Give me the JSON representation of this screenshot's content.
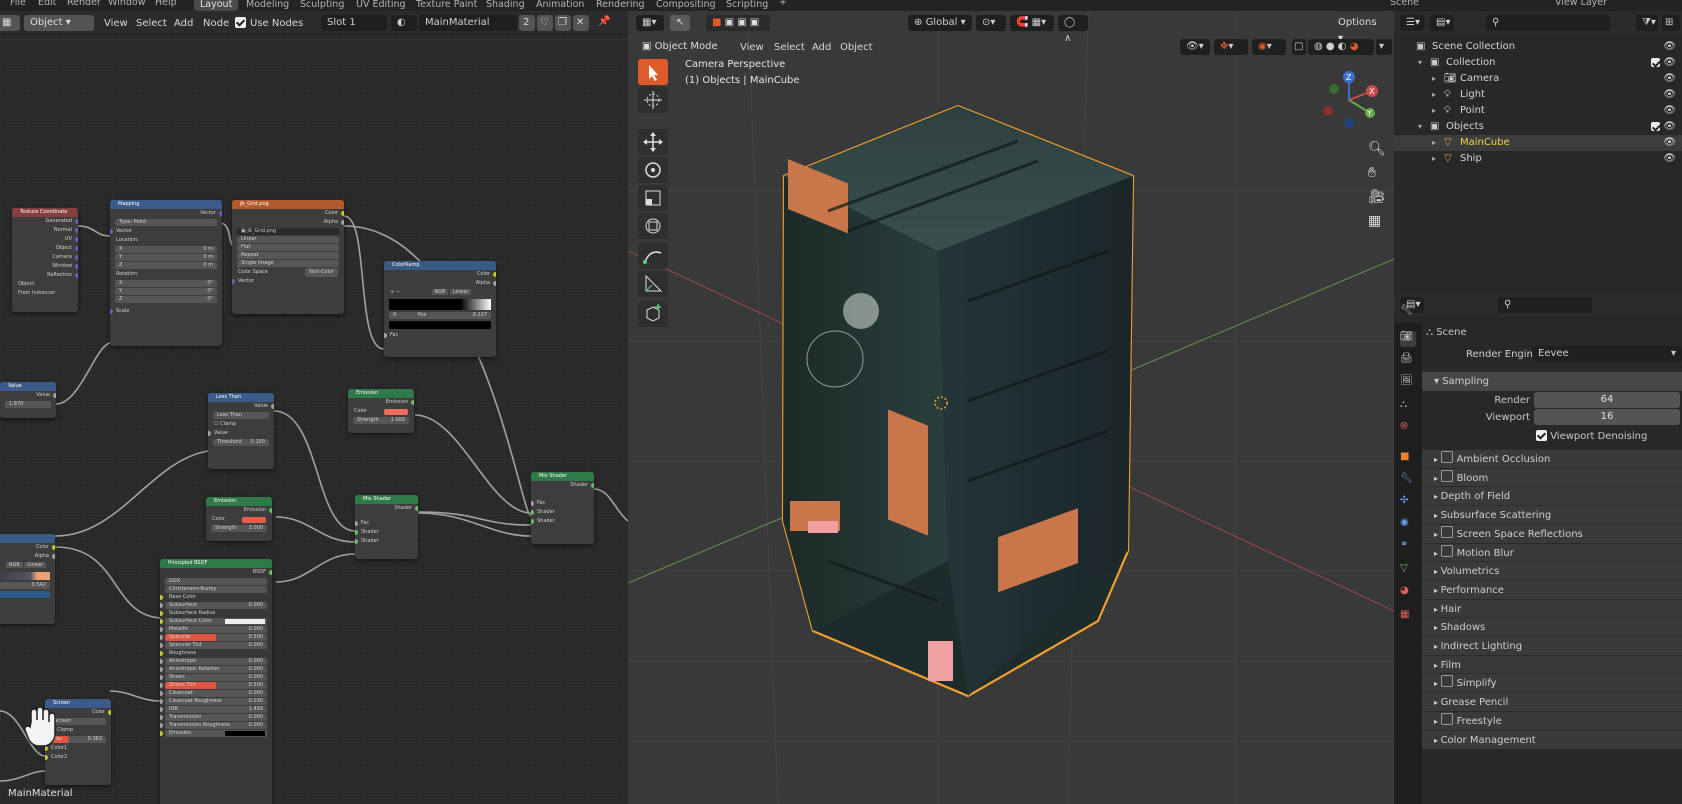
{
  "topbar": {
    "menus": [
      "File",
      "Edit",
      "Render",
      "Window",
      "Help"
    ],
    "workspaces": [
      "Layout",
      "Modeling",
      "Sculpting",
      "UV Editing",
      "Texture Paint",
      "Shading",
      "Animation",
      "Rendering",
      "Compositing",
      "Scripting"
    ],
    "add_tab": "+",
    "scene": "Scene",
    "view_layer": "View Layer"
  },
  "node_editor": {
    "mode": "Object",
    "menus": [
      "View",
      "Select",
      "Add",
      "Node"
    ],
    "use_nodes": "Use Nodes",
    "slot": "Slot 1",
    "material": "MainMaterial",
    "users": "2",
    "footer_material": "MainMaterial",
    "nodes": {
      "texcoord": {
        "title": "Texture Coordinate",
        "outputs": [
          "Generated",
          "Normal",
          "UV",
          "Object",
          "Camera",
          "Window",
          "Reflection"
        ],
        "object_label": "Object",
        "from_instancer": "From Instancer"
      },
      "mapping": {
        "title": "Mapping",
        "out": "Vector",
        "type_label": "Type:",
        "type_value": "Point",
        "vector": "Vector",
        "location": "Location:",
        "loc": [
          "0 m",
          "0 m",
          "0 m"
        ],
        "rotation": "Rotation:",
        "rot": [
          "0°",
          "0°",
          "0°"
        ],
        "axes": [
          "X",
          "Y",
          "Z"
        ],
        "scale": "Scale"
      },
      "image": {
        "title": "jb_Grid.png",
        "outputs": [
          "Color",
          "Alpha"
        ],
        "file": "jb_Grid.png",
        "interp": "Linear",
        "proj": "Flat",
        "ext": "Repeat",
        "source": "Single Image",
        "colorspace_label": "Color Space",
        "colorspace": "Non-Color",
        "vector": "Vector"
      },
      "colorramp": {
        "title": "ColorRamp",
        "outputs": [
          "Color",
          "Alpha"
        ],
        "mode": "RGB",
        "interp": "Linear",
        "pos_index": "0",
        "pos_label": "Pos",
        "pos_value": "0.227",
        "fac": "Fac"
      },
      "value": {
        "title": "Value",
        "out": "Value",
        "val": "1.870"
      },
      "lessthan": {
        "title": "Less Than",
        "out": "Value",
        "op": "Less Than",
        "clamp": "Clamp",
        "value": "Value",
        "threshold_label": "Threshold",
        "threshold": "0.100"
      },
      "emission1": {
        "title": "Emission",
        "out": "Emission",
        "color": "Color",
        "strength_label": "Strength",
        "strength": "1.000"
      },
      "emission2": {
        "title": "Emission",
        "out": "Emission",
        "color": "Color",
        "strength_label": "Strength",
        "strength": "3.000"
      },
      "mix1": {
        "title": "Mix Shader",
        "out": "Shader",
        "inputs": [
          "Fac",
          "Shader",
          "Shader"
        ]
      },
      "mix2": {
        "title": "Mix Shader",
        "out": "Shader",
        "inputs": [
          "Fac",
          "Shader",
          "Shader"
        ]
      },
      "bsdf": {
        "title": "Principled BSDF",
        "out": "BSDF",
        "dist": "GGX",
        "sss": "Christensen-Burley",
        "rows": [
          [
            "Base Color",
            ""
          ],
          [
            "Subsurface",
            "0.000"
          ],
          [
            "Subsurface Radius",
            ""
          ],
          [
            "Subsurface Color",
            ""
          ],
          [
            "Metallic",
            "0.000"
          ],
          [
            "Specular",
            "0.500"
          ],
          [
            "Specular Tint",
            "0.000"
          ],
          [
            "Roughness",
            ""
          ],
          [
            "Anisotropic",
            "0.000"
          ],
          [
            "Anisotropic Rotation",
            "0.000"
          ],
          [
            "Sheen",
            "0.000"
          ],
          [
            "Sheen Tint",
            "0.500"
          ],
          [
            "Clearcoat",
            "0.000"
          ],
          [
            "Clearcoat Roughness",
            "0.030"
          ],
          [
            "IOR",
            "1.450"
          ],
          [
            "Transmission",
            "0.000"
          ],
          [
            "Transmission Roughness",
            "0.000"
          ],
          [
            "Emission",
            ""
          ]
        ]
      },
      "screen": {
        "title": "Screen",
        "out": "Color",
        "mode": "Screen",
        "clamp": "Clamp",
        "fac_label": "Fac",
        "fac": "0.363",
        "in1": "Color1",
        "in2": "Color2"
      },
      "left1": {
        "outputs": [
          "Color",
          "Alpha"
        ],
        "ramp_a": "RGB",
        "ramp_b": "Linear",
        "val": "0.542"
      }
    }
  },
  "viewport": {
    "orientation": "Global",
    "options": "Options",
    "mode": "Object Mode",
    "menus": [
      "View",
      "Select",
      "Add",
      "Object"
    ],
    "info_line1": "Camera Perspective",
    "info_line2": "(1) Objects | MainCube",
    "gizmo": {
      "x": "X",
      "y": "Y",
      "z": "Z"
    }
  },
  "outliner": {
    "items": [
      {
        "label": "Scene Collection",
        "indent": 0
      },
      {
        "label": "Collection",
        "indent": 1
      },
      {
        "label": "Camera",
        "indent": 2
      },
      {
        "label": "Light",
        "indent": 2
      },
      {
        "label": "Point",
        "indent": 2
      },
      {
        "label": "Objects",
        "indent": 1
      },
      {
        "label": "MainCube",
        "indent": 2
      },
      {
        "label": "Ship",
        "indent": 2
      }
    ]
  },
  "properties": {
    "scene": "Scene",
    "render_engine_label": "Render Engine",
    "render_engine": "Eevee",
    "sampling": "Sampling",
    "render_label": "Render",
    "render_value": "64",
    "viewport_label": "Viewport",
    "viewport_value": "16",
    "denoise": "Viewport Denoising",
    "panels": [
      {
        "label": "Ambient Occlusion",
        "check": true
      },
      {
        "label": "Bloom",
        "check": true
      },
      {
        "label": "Depth of Field",
        "check": false
      },
      {
        "label": "Subsurface Scattering",
        "check": false
      },
      {
        "label": "Screen Space Reflections",
        "check": true
      },
      {
        "label": "Motion Blur",
        "check": true
      },
      {
        "label": "Volumetrics",
        "check": false
      },
      {
        "label": "Performance",
        "check": false
      },
      {
        "label": "Hair",
        "check": false
      },
      {
        "label": "Shadows",
        "check": false
      },
      {
        "label": "Indirect Lighting",
        "check": false
      },
      {
        "label": "Film",
        "check": false
      },
      {
        "label": "Simplify",
        "check": true
      },
      {
        "label": "Grease Pencil",
        "check": false
      },
      {
        "label": "Freestyle",
        "check": true
      },
      {
        "label": "Color Management",
        "check": false
      }
    ]
  },
  "colors": {
    "accent": "#e05a2b",
    "selection": "#f0a030",
    "node_orange": "#c8643a",
    "node_blue": "#2f5c8e",
    "node_green": "#2e7a48"
  }
}
